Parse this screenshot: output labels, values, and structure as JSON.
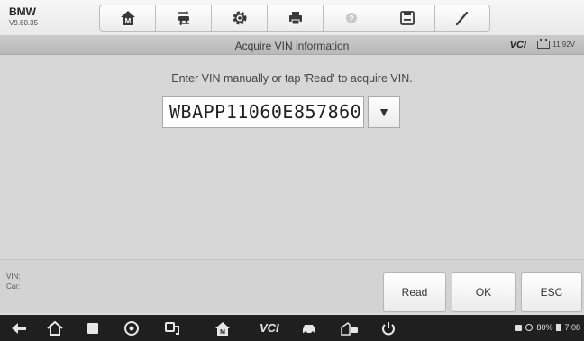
{
  "app": {
    "name": "BMW",
    "version": "V9.80.35"
  },
  "toolbar": {
    "tools": [
      {
        "icon": "home-icon"
      },
      {
        "icon": "vehicle-swap-icon"
      },
      {
        "icon": "gear-icon"
      },
      {
        "icon": "printer-icon"
      },
      {
        "icon": "help-icon"
      },
      {
        "icon": "save-icon"
      },
      {
        "icon": "pen-icon"
      }
    ]
  },
  "titlebar": {
    "title": "Acquire VIN information",
    "vci": "VCI",
    "voltage": "11.92V"
  },
  "main": {
    "prompt": "Enter VIN manually or tap 'Read' to acquire VIN.",
    "vin_value": "WBAPP11060E857860",
    "dropdown_glyph": "▼"
  },
  "info": {
    "vin_label": "VIN:",
    "car_label": "Car:"
  },
  "buttons": {
    "read": "Read",
    "ok": "OK",
    "esc": "ESC"
  },
  "navbar": {
    "vci": "VCI",
    "battery": "80%",
    "time": "7:08"
  },
  "colors": {
    "toolbar_bg": "#efefef",
    "title_bg": "#c2c2c2",
    "nav_bg": "#1f1f1f",
    "icon_dark": "#3a3a3a"
  }
}
